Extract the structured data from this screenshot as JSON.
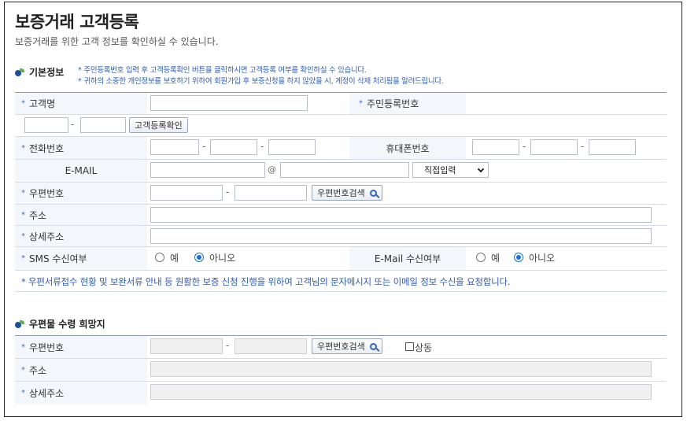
{
  "page": {
    "title": "보증거래 고객등록",
    "subtitle": "보증거래를 위한 고객 정보를 확인하실 수 있습니다."
  },
  "basic_info": {
    "heading": "기본정보",
    "notes": [
      "주민등록번호 입력 후 고객등록확인 버튼을 클릭하시면 고객등록 여부를 확인하실 수 있습니다.",
      "귀하의 소중한 개인정보를 보호하기 위하여 회원가입 후 보증신청을 하지 않았을 시, 계정이 삭제 처리됨을 알려드립니다."
    ],
    "note_marker": "*",
    "required_marker": "*",
    "customer_name_label": "고객명",
    "resident_number_label": "주민등록번호",
    "check_registration_button": "고객등록확인",
    "phone_label": "전화번호",
    "mobile_label": "휴대폰번호",
    "email_label": "E-MAIL",
    "email_at": "@",
    "email_domain_select": "직접입력",
    "postcode_label": "우편번호",
    "postcode_search_button": "우편번호검색",
    "address_label": "주소",
    "detail_address_label": "상세주소",
    "sms_label": "SMS 수신여부",
    "email_receive_label": "E-Mail 수신여부",
    "radio_yes": "예",
    "radio_no": "아니오",
    "sms_selected": "아니오",
    "email_selected": "아니오",
    "consent_note": "우편서류접수 현황 및 보완서류 안내 등 원활한 보증 신청 진행을 위하여 고객님의 문자메시지 또는 이메일 정보 수신을 요청합니다.",
    "dash": "-"
  },
  "mail_section": {
    "heading": "우편물 수령 희망지",
    "postcode_label": "우편번호",
    "postcode_search_button": "우편번호검색",
    "same_checkbox_label": "상동",
    "address_label": "주소",
    "detail_address_label": "상세주소"
  }
}
